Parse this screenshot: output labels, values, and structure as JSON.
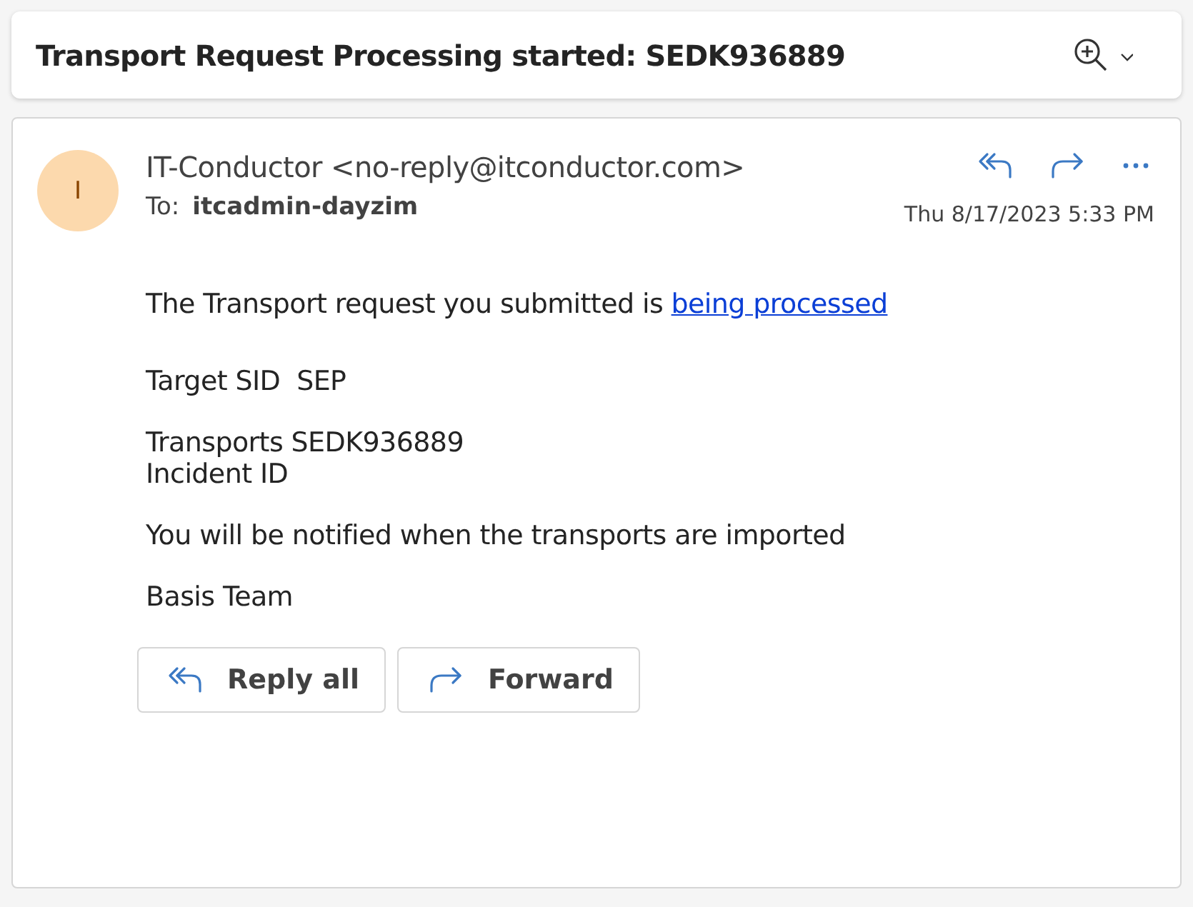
{
  "subject": "Transport Request Processing started: SEDK936889",
  "message": {
    "avatar_initial": "I",
    "sender": "IT-Conductor <no-reply@itconductor.com>",
    "to_label": "To:",
    "recipient": "itcadmin-dayzim",
    "date": "Thu 8/17/2023 5:33 PM",
    "body": {
      "intro": "The Transport request you submitted is ",
      "link": "being processed",
      "paragraphs": [
        [
          "Target SID  SEP"
        ],
        [
          "Transports SEDK936889",
          "Incident ID"
        ],
        [
          "You will be notified when the transports are imported"
        ],
        [
          "Basis Team"
        ]
      ]
    }
  },
  "actions": [
    {
      "kind": "reply-all",
      "label": "Reply all"
    },
    {
      "kind": "forward",
      "label": "Forward"
    }
  ]
}
